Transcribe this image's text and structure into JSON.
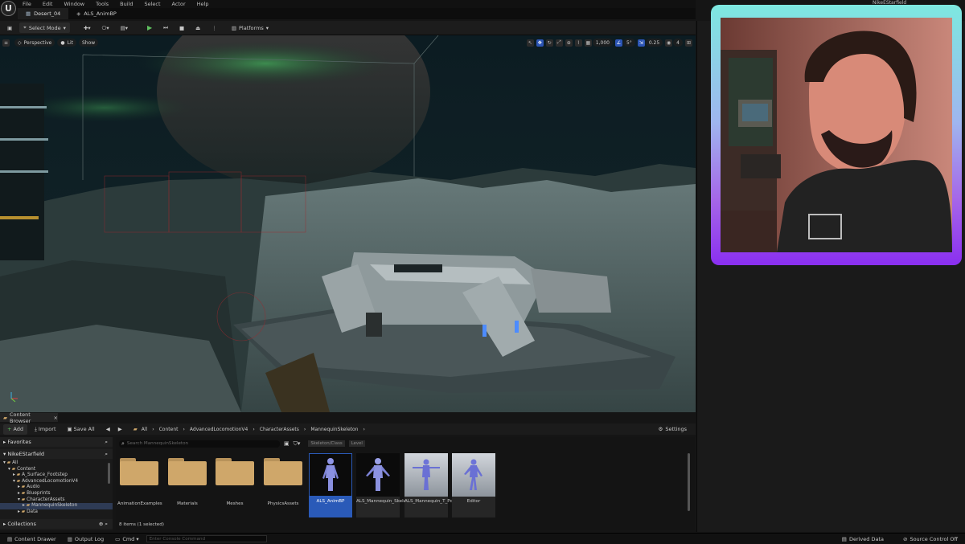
{
  "menu": [
    "File",
    "Edit",
    "Window",
    "Tools",
    "Build",
    "Select",
    "Actor",
    "Help"
  ],
  "user_name_top": "NikeEStarfield",
  "tabs": [
    "Desert_04",
    "ALS_AnimBP"
  ],
  "toolbar": {
    "select_mode": "Select Mode",
    "platforms": "Platforms"
  },
  "viewport": {
    "perspective": "Perspective",
    "lit": "Lit",
    "show": "Show",
    "grid_value": "1,000",
    "angle_value": "5°",
    "scale_value": "0.25",
    "camera_speed": "4"
  },
  "content_browser": {
    "tab_label": "Content Browser",
    "add": "Add",
    "import": "Import",
    "save_all": "Save All",
    "breadcrumb": [
      "All",
      "Content",
      "AdvancedLocomotionV4",
      "CharacterAssets",
      "MannequinSkeleton"
    ],
    "settings": "Settings",
    "search_placeholder": "Search MannequinSkeleton",
    "filter_chips": [
      "Skeleton/Class",
      "Level"
    ],
    "favorites": "Favorites",
    "project": "NikeEStarfield",
    "collections": "Collections",
    "tree": [
      "All",
      "Content",
      "A_Surface_Footstep",
      "AdvancedLocomotionV4",
      "Audio",
      "Blueprints",
      "CharacterAssets",
      "MannequinSkeleton",
      "Data"
    ],
    "items": [
      {
        "label": "AnimationExamples",
        "kind": "folder"
      },
      {
        "label": "Materials",
        "kind": "folder"
      },
      {
        "label": "Meshes",
        "kind": "folder"
      },
      {
        "label": "PhysicsAssets",
        "kind": "folder"
      },
      {
        "label": "ALS_AnimBP",
        "kind": "animbp"
      },
      {
        "label": "ALS_Mannequin_Skeleton",
        "kind": "skeleton"
      },
      {
        "label": "ALS_Mannequin_T_Pose",
        "kind": "pose"
      },
      {
        "label": "Editor",
        "kind": "pose"
      }
    ],
    "item_count": "8 items (1 selected)"
  },
  "status": {
    "content_drawer": "Content Drawer",
    "output_log": "Output Log",
    "cmd": "Cmd",
    "console_placeholder": "Enter Console Command",
    "derived_data": "Derived Data",
    "source_control": "Source Control Off"
  },
  "colors": {
    "accent_blue": "#2a5ab8",
    "folder": "#cfa76a",
    "cam_border_top": "#7de8e0",
    "cam_border_bottom": "#8a2ff0"
  }
}
